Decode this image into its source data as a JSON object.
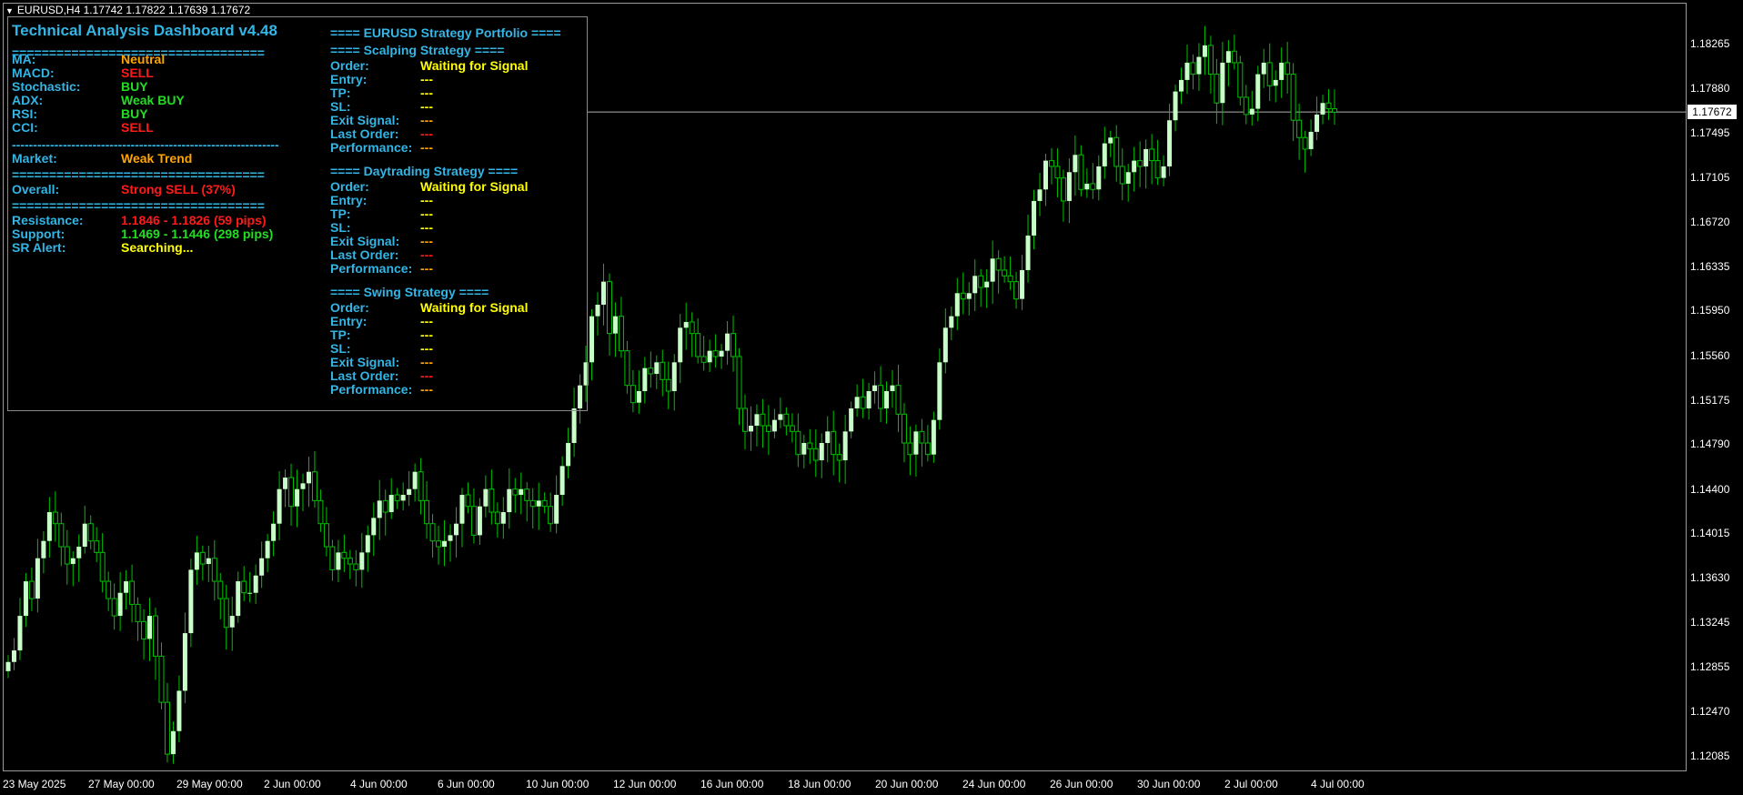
{
  "window": {
    "symbol_header": "EURUSD,H4  1.17742 1.17822 1.17639 1.17672"
  },
  "colors": {
    "bull_candle": "#c8ffc8",
    "bear_candle": "#00c000",
    "label_cyan": "#33b5e5",
    "orange": "#ffa500",
    "red": "#ff1a1a",
    "green": "#22dd22",
    "yellow": "#ffff00"
  },
  "price_axis": {
    "ticks": [
      "1.18265",
      "1.17880",
      "1.17495",
      "1.17105",
      "1.16720",
      "1.16335",
      "1.15950",
      "1.15560",
      "1.15175",
      "1.14790",
      "1.14400",
      "1.14015",
      "1.13630",
      "1.13245",
      "1.12855",
      "1.12470",
      "1.12085"
    ],
    "current_price": "1.17672"
  },
  "time_axis": {
    "ticks": [
      "23 May 2025",
      "27 May 00:00",
      "29 May 00:00",
      "2 Jun 00:00",
      "4 Jun 00:00",
      "6 Jun 00:00",
      "10 Jun 00:00",
      "12 Jun 00:00",
      "16 Jun 00:00",
      "18 Jun 00:00",
      "20 Jun 00:00",
      "24 Jun 00:00",
      "26 Jun 00:00",
      "30 Jun 00:00",
      "2 Jul 00:00",
      "4 Jul 00:00"
    ]
  },
  "chart_data": {
    "type": "candlestick",
    "symbol": "EURUSD",
    "timeframe": "H4",
    "ylim": [
      1.119,
      1.186
    ],
    "current_price": 1.17672,
    "closes": [
      1.129,
      1.13,
      1.133,
      1.136,
      1.1345,
      1.138,
      1.1395,
      1.142,
      1.141,
      1.139,
      1.1375,
      1.138,
      1.139,
      1.141,
      1.1395,
      1.1385,
      1.136,
      1.1345,
      1.133,
      1.135,
      1.136,
      1.134,
      1.1325,
      1.131,
      1.133,
      1.1295,
      1.1255,
      1.121,
      1.123,
      1.1265,
      1.1315,
      1.137,
      1.1385,
      1.1375,
      1.138,
      1.136,
      1.1345,
      1.132,
      1.133,
      1.136,
      1.135,
      1.135,
      1.1365,
      1.138,
      1.1395,
      1.141,
      1.144,
      1.145,
      1.1425,
      1.144,
      1.1445,
      1.1455,
      1.143,
      1.141,
      1.139,
      1.137,
      1.1385,
      1.138,
      1.1375,
      1.137,
      1.1385,
      1.14,
      1.1415,
      1.143,
      1.142,
      1.1435,
      1.143,
      1.1435,
      1.144,
      1.1455,
      1.143,
      1.141,
      1.1395,
      1.139,
      1.1395,
      1.14,
      1.141,
      1.1435,
      1.1425,
      1.14,
      1.1425,
      1.144,
      1.142,
      1.141,
      1.142,
      1.144,
      1.1435,
      1.144,
      1.143,
      1.1425,
      1.143,
      1.1425,
      1.141,
      1.1435,
      1.146,
      1.148,
      1.151,
      1.153,
      1.155,
      1.159,
      1.16,
      1.162,
      1.1575,
      1.159,
      1.156,
      1.153,
      1.1515,
      1.1525,
      1.1545,
      1.154,
      1.155,
      1.1535,
      1.1525,
      1.155,
      1.158,
      1.1585,
      1.1575,
      1.1555,
      1.155,
      1.156,
      1.1555,
      1.156,
      1.1575,
      1.1555,
      1.151,
      1.149,
      1.1495,
      1.1505,
      1.1495,
      1.149,
      1.15,
      1.1505,
      1.1495,
      1.149,
      1.147,
      1.148,
      1.1475,
      1.1465,
      1.148,
      1.149,
      1.147,
      1.1465,
      1.149,
      1.151,
      1.152,
      1.151,
      1.1525,
      1.153,
      1.151,
      1.1525,
      1.153,
      1.1505,
      1.148,
      1.147,
      1.149,
      1.148,
      1.147,
      1.15,
      1.155,
      1.158,
      1.159,
      1.161,
      1.1605,
      1.161,
      1.1625,
      1.1615,
      1.162,
      1.164,
      1.163,
      1.1625,
      1.162,
      1.1605,
      1.163,
      1.166,
      1.169,
      1.17,
      1.1725,
      1.172,
      1.171,
      1.169,
      1.1715,
      1.173,
      1.17,
      1.1705,
      1.17,
      1.172,
      1.174,
      1.1745,
      1.172,
      1.1705,
      1.1715,
      1.1725,
      1.172,
      1.1735,
      1.1725,
      1.171,
      1.172,
      1.176,
      1.1785,
      1.1795,
      1.181,
      1.18,
      1.1815,
      1.1825,
      1.18,
      1.1775,
      1.181,
      1.182,
      1.181,
      1.178,
      1.1765,
      1.177,
      1.18,
      1.181,
      1.179,
      1.1795,
      1.181,
      1.18,
      1.176,
      1.1745,
      1.1735,
      1.175,
      1.1765,
      1.1775,
      1.177,
      1.1767
    ]
  },
  "dashboard": {
    "title": "Technical Analysis Dashboard v4.48",
    "sep_equals": "==================================",
    "sep_dashes": "---------------------------------------------------------------",
    "indicators": [
      {
        "label": "MA:",
        "value": "Neutral",
        "status": "orange"
      },
      {
        "label": "MACD:",
        "value": "SELL",
        "status": "red"
      },
      {
        "label": "Stochastic:",
        "value": "BUY",
        "status": "green"
      },
      {
        "label": "ADX:",
        "value": "Weak BUY",
        "status": "green"
      },
      {
        "label": "RSI:",
        "value": "BUY",
        "status": "green"
      },
      {
        "label": "CCI:",
        "value": "SELL",
        "status": "red"
      }
    ],
    "market": {
      "label": "Market:",
      "value": "Weak Trend"
    },
    "overall": {
      "label": "Overall:",
      "value": "Strong SELL (37%)"
    },
    "levels": [
      {
        "label": "Resistance:",
        "value": "1.1846 - 1.1826 (59 pips)",
        "status": "red"
      },
      {
        "label": "Support:",
        "value": "1.1469 - 1.1446 (298 pips)",
        "status": "green"
      },
      {
        "label": "SR Alert:",
        "value": "Searching...",
        "status": "yellow"
      }
    ],
    "portfolio_title": "==== EURUSD Strategy Portfolio ====",
    "strategies": [
      {
        "title": "==== Scalping Strategy ====",
        "rows": [
          {
            "label": "Order:",
            "value": "Waiting for Signal",
            "status": "yellow"
          },
          {
            "label": "Entry:",
            "value": "---",
            "status": "yellow"
          },
          {
            "label": "TP:",
            "value": "---",
            "status": "yellow"
          },
          {
            "label": "SL:",
            "value": "---",
            "status": "yellow"
          },
          {
            "label": "Exit Signal:",
            "value": "---",
            "status": "orange"
          },
          {
            "label": "Last Order:",
            "value": "---",
            "status": "red"
          },
          {
            "label": "Performance:",
            "value": "---",
            "status": "orange"
          }
        ]
      },
      {
        "title": "==== Daytrading Strategy ====",
        "rows": [
          {
            "label": "Order:",
            "value": "Waiting for Signal",
            "status": "yellow"
          },
          {
            "label": "Entry:",
            "value": "---",
            "status": "yellow"
          },
          {
            "label": "TP:",
            "value": "---",
            "status": "yellow"
          },
          {
            "label": "SL:",
            "value": "---",
            "status": "yellow"
          },
          {
            "label": "Exit Signal:",
            "value": "---",
            "status": "orange"
          },
          {
            "label": "Last Order:",
            "value": "---",
            "status": "red"
          },
          {
            "label": "Performance:",
            "value": "---",
            "status": "orange"
          }
        ]
      },
      {
        "title": "==== Swing Strategy ====",
        "rows": [
          {
            "label": "Order:",
            "value": "Waiting for Signal",
            "status": "yellow"
          },
          {
            "label": "Entry:",
            "value": "---",
            "status": "yellow"
          },
          {
            "label": "TP:",
            "value": "---",
            "status": "yellow"
          },
          {
            "label": "SL:",
            "value": "---",
            "status": "yellow"
          },
          {
            "label": "Exit Signal:",
            "value": "---",
            "status": "orange"
          },
          {
            "label": "Last Order:",
            "value": "---",
            "status": "red"
          },
          {
            "label": "Performance:",
            "value": "---",
            "status": "orange"
          }
        ]
      }
    ]
  }
}
